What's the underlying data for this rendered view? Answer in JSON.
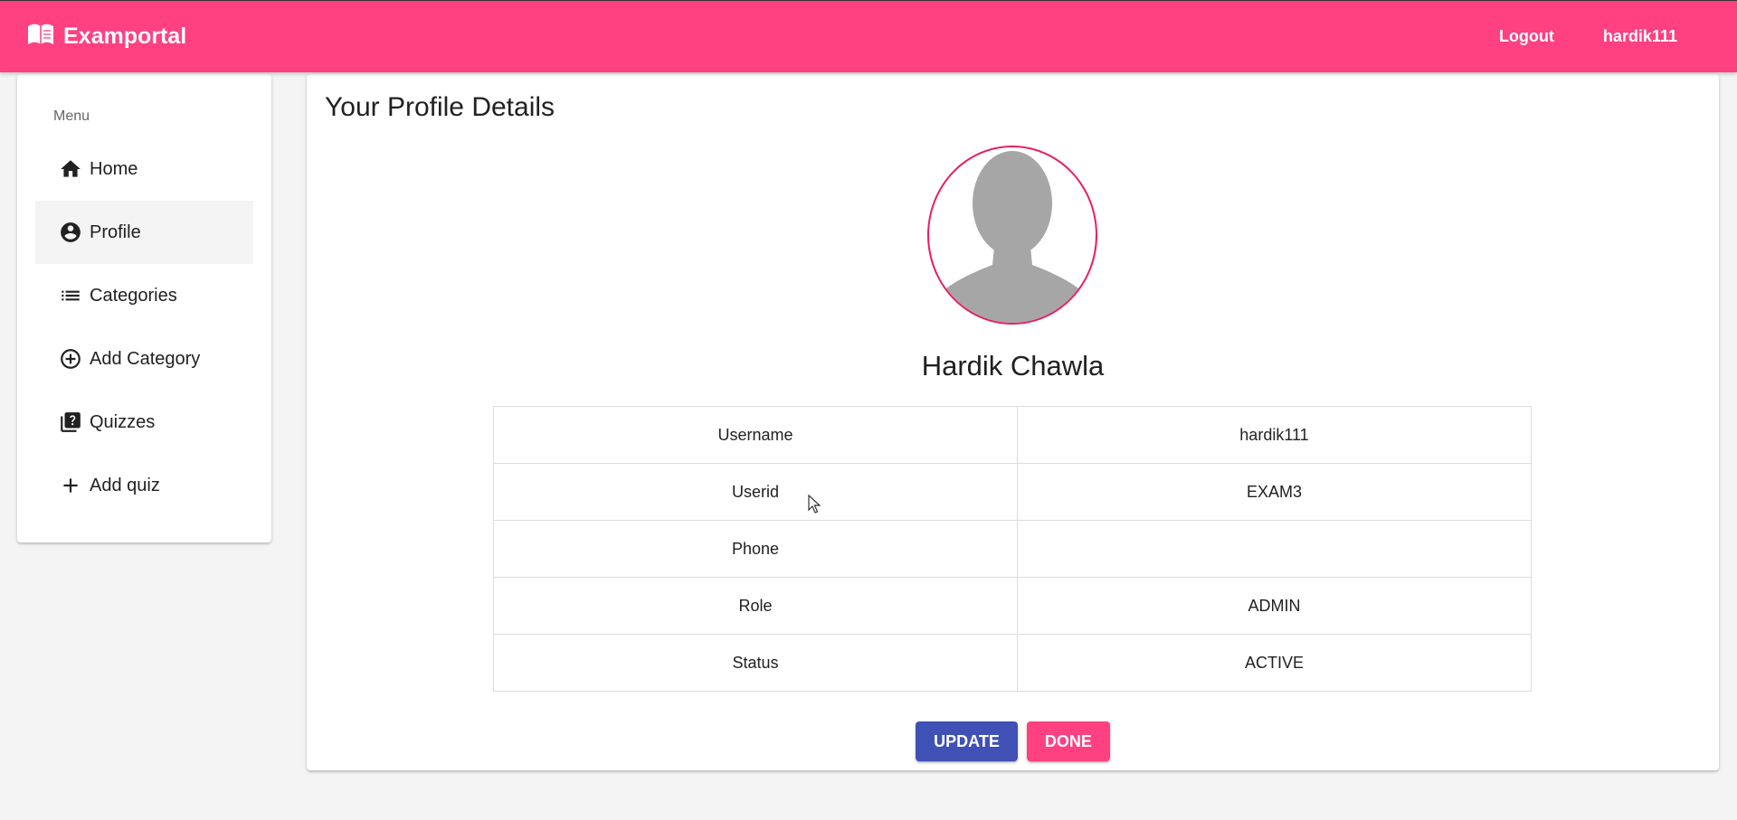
{
  "colors": {
    "primary": "#3f51b5",
    "accent": "#ff4081",
    "background": "#f4f4f4"
  },
  "header": {
    "brand_icon": "book-open-icon",
    "title": "Examportal",
    "logout_label": "Logout",
    "username_label": "hardik111"
  },
  "sidebar": {
    "title": "Menu",
    "items": [
      {
        "label": "Home",
        "icon": "home-icon"
      },
      {
        "label": "Profile",
        "icon": "account-circle-icon",
        "active": true
      },
      {
        "label": "Categories",
        "icon": "list-icon"
      },
      {
        "label": "Add Category",
        "icon": "add-circle-outline-icon"
      },
      {
        "label": "Quizzes",
        "icon": "quiz-icon"
      },
      {
        "label": "Add quiz",
        "icon": "add-icon"
      }
    ]
  },
  "main": {
    "title": "Your Profile Details",
    "avatar_icon": "user-silhouette-icon",
    "profile_name": "Hardik Chawla",
    "details": [
      {
        "label": "Username",
        "value": "hardik111"
      },
      {
        "label": "Userid",
        "value": "EXAM3"
      },
      {
        "label": "Phone",
        "value": ""
      },
      {
        "label": "Role",
        "value": "ADMIN"
      },
      {
        "label": "Status",
        "value": "ACTIVE"
      }
    ],
    "update_label": "UPDATE",
    "done_label": "DONE"
  }
}
